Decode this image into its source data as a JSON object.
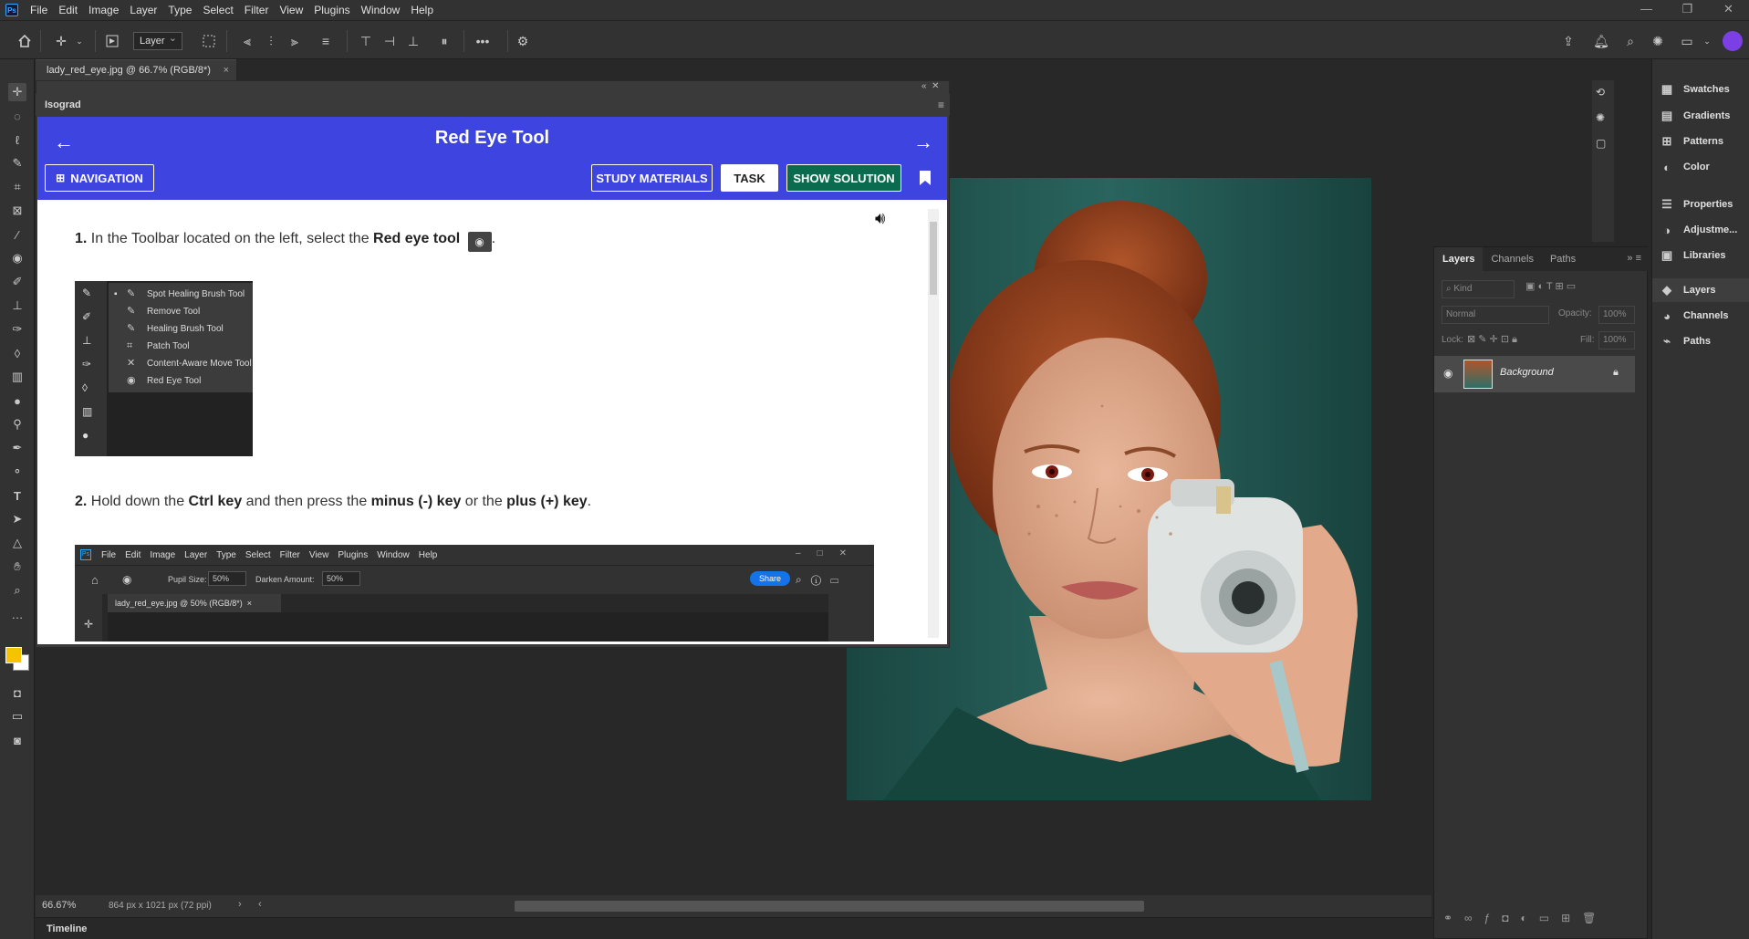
{
  "app": {
    "logo": "Ps",
    "menu": [
      "File",
      "Edit",
      "Image",
      "Layer",
      "Type",
      "Select",
      "Filter",
      "View",
      "Plugins",
      "Window",
      "Help"
    ],
    "window_controls": [
      "—",
      "❐",
      "✕"
    ]
  },
  "options_bar": {
    "auto_select_target": "Layer"
  },
  "document": {
    "tab_title": "lady_red_eye.jpg @ 66.7% (RGB/8*)",
    "zoom": "66.67%",
    "dimensions": "864 px x 1021 px (72 ppi)"
  },
  "isograd": {
    "panel_title": "Isograd",
    "lesson_title": "Red Eye Tool",
    "buttons": {
      "navigation": "NAVIGATION",
      "study_materials": "STUDY MATERIALS",
      "task": "TASK",
      "show_solution": "SHOW SOLUTION"
    },
    "step1": {
      "number": "1.",
      "text_before": "In the Toolbar located on the left, select the ",
      "bold": "Red eye tool",
      "text_after": "."
    },
    "flyout_items": [
      "Spot Healing Brush Tool",
      "Remove Tool",
      "Healing Brush Tool",
      "Patch Tool",
      "Content-Aware Move Tool",
      "Red Eye Tool"
    ],
    "step2": {
      "number": "2.",
      "t1": "Hold down the ",
      "b1": "Ctrl key",
      "t2": " and then press the ",
      "b2": "minus (-) key",
      "t3": " or the ",
      "b3": "plus (+) key",
      "t4": "."
    },
    "embedded_ps": {
      "menu": [
        "File",
        "Edit",
        "Image",
        "Layer",
        "Type",
        "Select",
        "Filter",
        "View",
        "Plugins",
        "Window",
        "Help"
      ],
      "pupil_label": "Pupil Size:",
      "pupil_value": "50%",
      "darken_label": "Darken Amount:",
      "darken_value": "50%",
      "share": "Share",
      "tab_title": "lady_red_eye.jpg @ 50% (RGB/8*)"
    }
  },
  "properties_panel": [
    "Swatches",
    "Gradients",
    "Patterns",
    "Color",
    "Properties",
    "Adjustme...",
    "Libraries",
    "Layers",
    "Channels",
    "Paths"
  ],
  "layers_panel": {
    "tabs": [
      "Layers",
      "Channels",
      "Paths"
    ],
    "kind": "Kind",
    "blend_mode": "Normal",
    "opacity_label": "Opacity:",
    "opacity_value": "100%",
    "lock_label": "Lock:",
    "fill_label": "Fill:",
    "fill_value": "100%",
    "layer_name": "Background"
  },
  "timeline": "Timeline",
  "colors": {
    "isograd_blue": "#3d44e0",
    "solution_green": "#0b6b4f",
    "foreground": "#f5c400"
  }
}
